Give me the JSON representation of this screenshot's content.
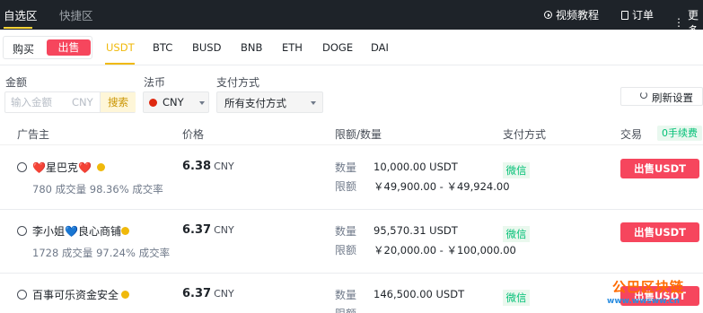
{
  "topbar": {
    "tabs": [
      "自选区",
      "快捷区"
    ],
    "video_tutorial": "视频教程",
    "orders": "订单",
    "more": "更多"
  },
  "trade_toggle": {
    "buy": "购买",
    "sell": "出售"
  },
  "coins": [
    "USDT",
    "BTC",
    "BUSD",
    "BNB",
    "ETH",
    "DOGE",
    "DAI"
  ],
  "active_coin": "USDT",
  "filters": {
    "amount_label": "金额",
    "amount_placeholder": "输入金额",
    "amount_currency": "CNY",
    "search_label": "搜索",
    "fiat_label": "法币",
    "fiat_value": "CNY",
    "payment_label": "支付方式",
    "payment_value": "所有支付方式",
    "refresh_label": "刷新设置"
  },
  "table": {
    "headers": {
      "advertiser": "广告主",
      "price": "价格",
      "limit_amount": "限额/数量",
      "payment": "支付方式",
      "trade": "交易",
      "zero_fee": "0手续费"
    },
    "labels": {
      "amount": "数量",
      "limit": "限额"
    },
    "rows": [
      {
        "name": "❤️星巴克❤️",
        "orders": "780 成交量",
        "rate": "98.36% 成交率",
        "price": "6.38",
        "currency": "CNY",
        "amount": "10,000.00 USDT",
        "limit": "￥49,900.00 - ￥49,924.00",
        "payment": "微信",
        "action": "出售USDT"
      },
      {
        "name": "李小姐💙良心商铺",
        "orders": "1728 成交量",
        "rate": "97.24% 成交率",
        "price": "6.37",
        "currency": "CNY",
        "amount": "95,570.31 USDT",
        "limit": "￥20,000.00 - ￥100,000.00",
        "payment": "微信",
        "action": "出售USDT"
      },
      {
        "name": "百事可乐资金安全",
        "orders": "",
        "rate": "",
        "price": "6.37",
        "currency": "CNY",
        "amount": "146,500.00 USDT",
        "limit": "",
        "payment": "微信",
        "action": "出售USDT"
      }
    ]
  },
  "watermark": {
    "title": "公巴区块链",
    "url": "www.wwsww.cn"
  }
}
